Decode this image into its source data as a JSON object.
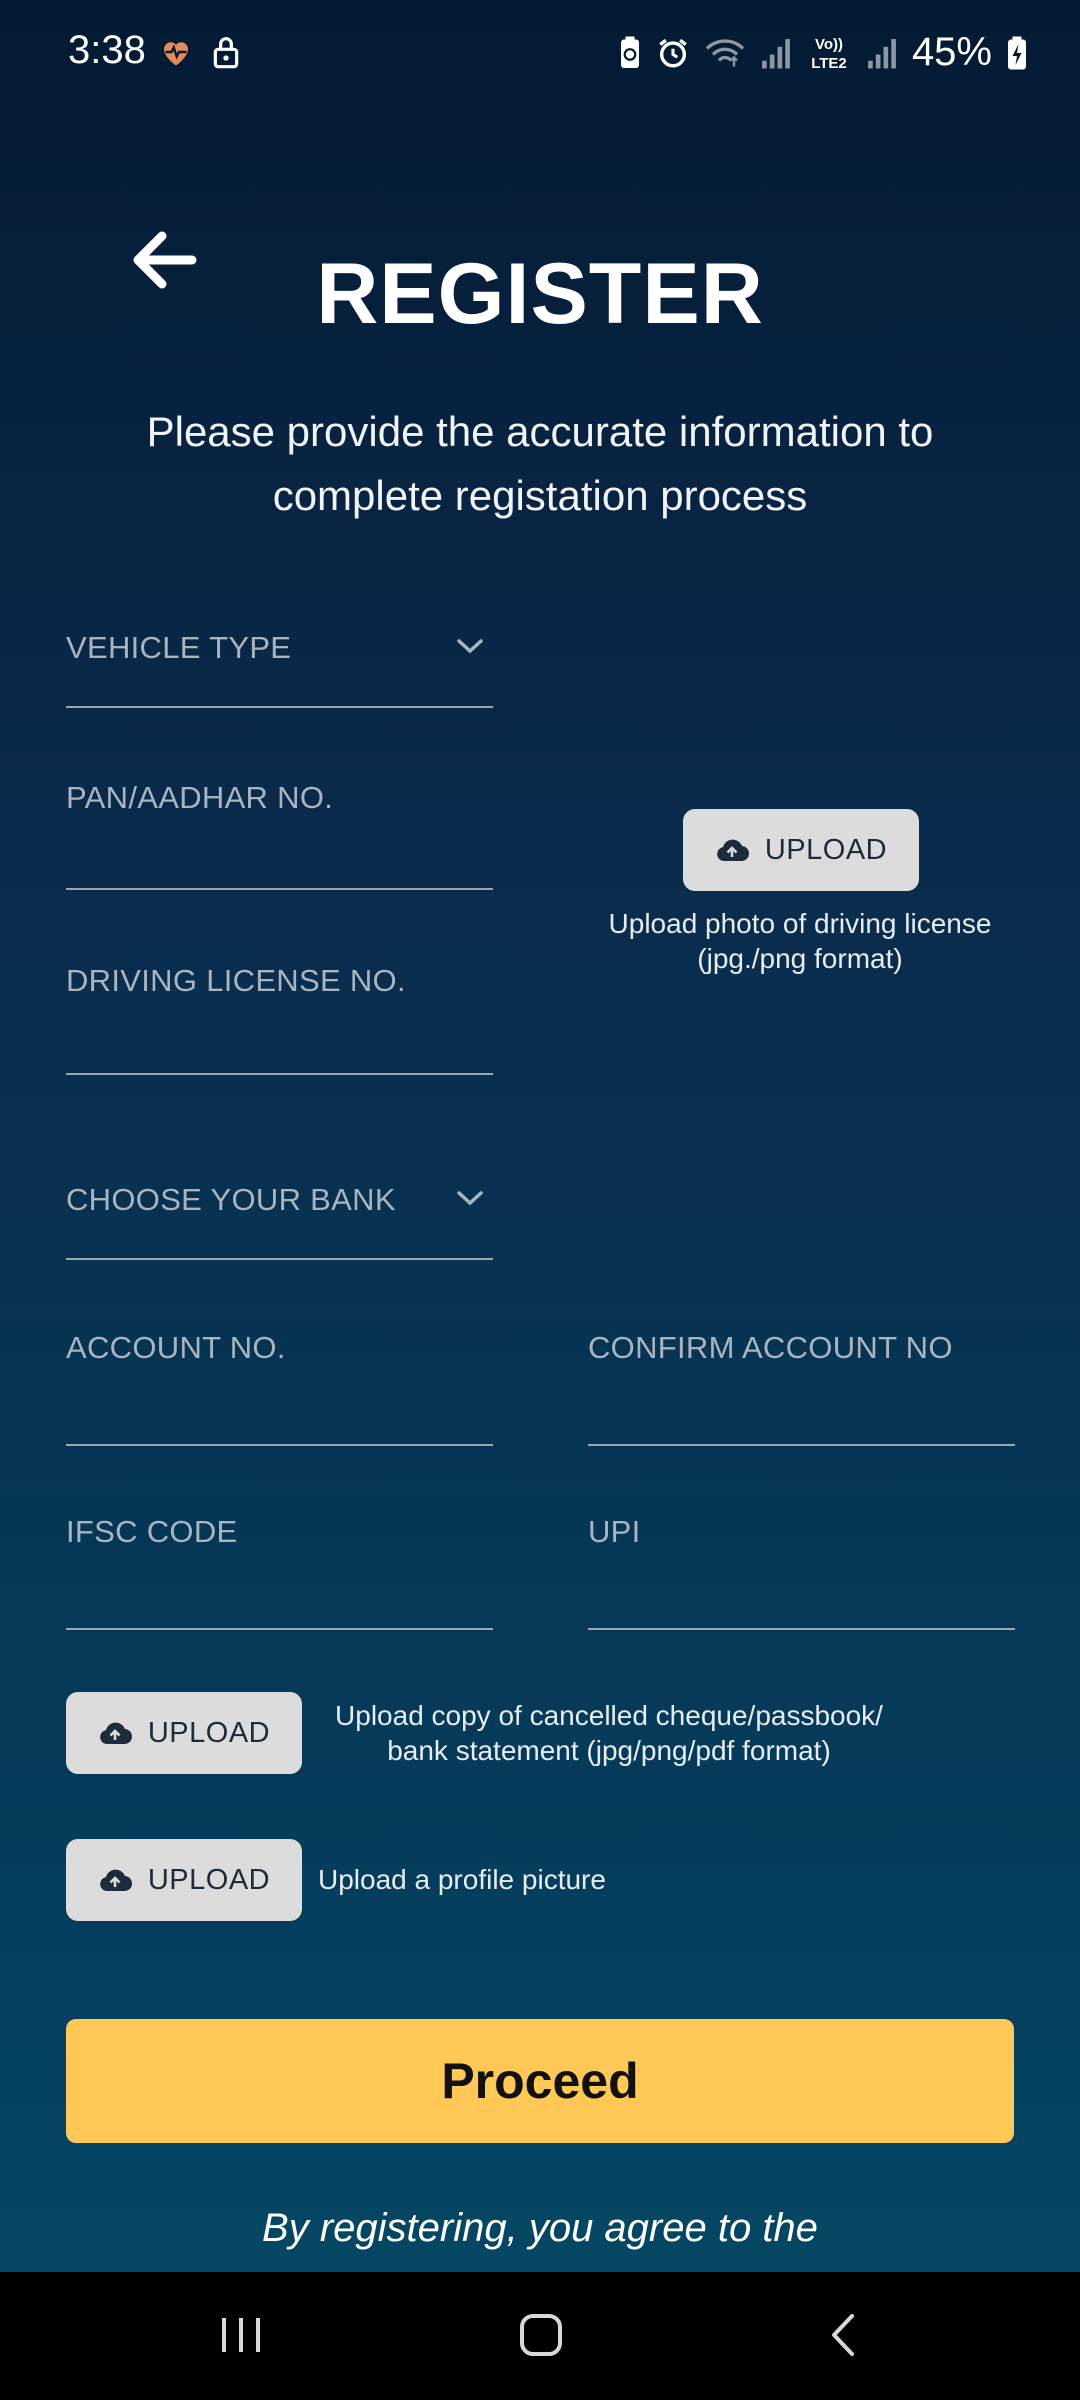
{
  "status_bar": {
    "time": "3:38",
    "battery": "45%",
    "left_icons": [
      "heart-rate-icon",
      "lock-icon"
    ],
    "right_icons": [
      "battery-saver-icon",
      "alarm-icon",
      "wifi-icon",
      "signal-icon",
      "volte-icon",
      "signal-icon"
    ],
    "volte_text": "Vo)) LTE2"
  },
  "header": {
    "title": "REGISTER",
    "subtitle": "Please provide the accurate information to complete registation process"
  },
  "form": {
    "vehicle_type": "VEHICLE TYPE",
    "pan_aadhar": "PAN/AADHAR NO.",
    "driving_license": "DRIVING LICENSE NO.",
    "bank": "CHOOSE YOUR BANK",
    "account_no": "ACCOUNT NO.",
    "confirm_account_no": "CONFIRM ACCOUNT NO",
    "ifsc": "IFSC CODE",
    "upi": "UPI"
  },
  "uploads": {
    "button_label": "UPLOAD",
    "dl_note": "Upload photo of driving license (jpg./png format)",
    "cheque_note": "Upload copy of cancelled cheque/passbook/ bank statement (jpg/png/pdf format)",
    "profile_note": "Upload a profile picture"
  },
  "actions": {
    "proceed": "Proceed"
  },
  "footer": {
    "terms": "By registering, you agree to the"
  },
  "colors": {
    "accent": "#ffc857",
    "upload_bg": "#dcdcdc",
    "bg_top": "#041a33",
    "bg_bottom": "#054a66"
  }
}
